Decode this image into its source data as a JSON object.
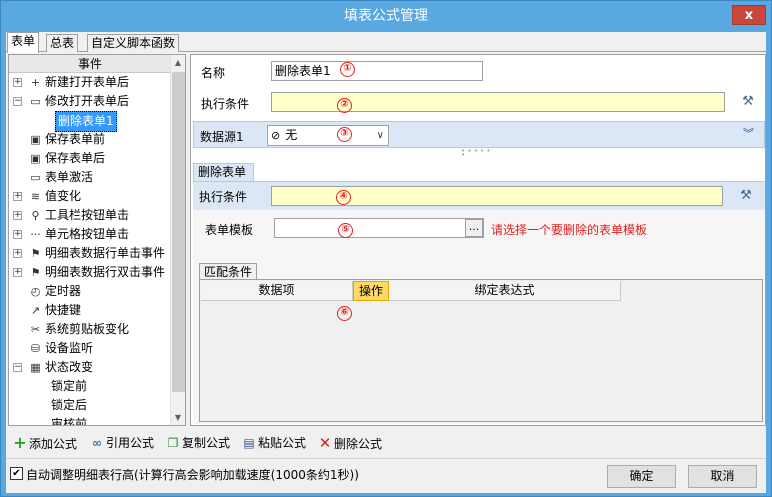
{
  "window": {
    "title": "填表公式管理",
    "close": "x"
  },
  "tabs": [
    "表单",
    "总表",
    "自定义脚本函数"
  ],
  "left": {
    "header": "事件",
    "items": [
      {
        "label": "新建打开表单后",
        "icon": "user-add-icon",
        "glyph": "+"
      },
      {
        "label": "修改打开表单后",
        "icon": "folder-open-icon",
        "glyph": "▭"
      },
      {
        "label": "删除表单1",
        "icon": "",
        "glyph": ""
      },
      {
        "label": "保存表单前",
        "icon": "save-icon",
        "glyph": "▣"
      },
      {
        "label": "保存表单后",
        "icon": "save-icon",
        "glyph": "▣"
      },
      {
        "label": "表单激活",
        "icon": "folder-icon",
        "glyph": "▭"
      },
      {
        "label": "值变化",
        "icon": "value-change-icon",
        "glyph": "≋"
      },
      {
        "label": "工具栏按钮单击",
        "icon": "toolbar-icon",
        "glyph": "⚲"
      },
      {
        "label": "单元格按钮单击",
        "icon": "dots-icon",
        "glyph": "···"
      },
      {
        "label": "明细表数据行单击事件",
        "icon": "flag-icon",
        "glyph": "⚑"
      },
      {
        "label": "明细表数据行双击事件",
        "icon": "flag-icon",
        "glyph": "⚑"
      },
      {
        "label": "定时器",
        "icon": "timer-icon",
        "glyph": "◴"
      },
      {
        "label": "快捷键",
        "icon": "shortcut-icon",
        "glyph": "↗"
      },
      {
        "label": "系统剪贴板变化",
        "icon": "scissors-icon",
        "glyph": "✂"
      },
      {
        "label": "设备监听",
        "icon": "device-icon",
        "glyph": "⛁"
      },
      {
        "label": "状态改变",
        "icon": "status-icon",
        "glyph": "▦"
      },
      {
        "label": "锁定前",
        "icon": "",
        "glyph": ""
      },
      {
        "label": "锁定后",
        "icon": "",
        "glyph": ""
      },
      {
        "label": "审核前",
        "icon": "",
        "glyph": ""
      }
    ]
  },
  "form": {
    "name_label": "名称",
    "name_value": "删除表单1",
    "exec_label": "执行条件",
    "exec_value": "",
    "ds_label": "数据源1",
    "ds_value": "无",
    "section_label": "删除表单",
    "exec2_label": "执行条件",
    "exec2_value": "",
    "template_label": "表单模板",
    "template_value": "",
    "browse": "...",
    "template_hint": "请选择一个要删除的表单模板",
    "match_tab": "匹配条件",
    "columns": [
      "数据项",
      "操作",
      "绑定表达式"
    ],
    "badges": [
      "①",
      "②",
      "③",
      "④",
      "⑤",
      "⑥"
    ]
  },
  "toolbar": {
    "add": "添加公式",
    "ref": "引用公式",
    "copy": "复制公式",
    "paste": "粘贴公式",
    "delete": "删除公式"
  },
  "bottom": {
    "checkbox_checked": true,
    "checkbox_label": "自动调整明细表行高(计算行高会影响加载速度(1000条约1秒))",
    "ok": "确定",
    "cancel": "取消"
  },
  "colors": {
    "title_bar": "#59a8df",
    "close_button": "#c9463d",
    "highlight": "#ffffcc",
    "selected": "#3399ff",
    "badge": "#e02020",
    "band": "#dbe7f4"
  }
}
